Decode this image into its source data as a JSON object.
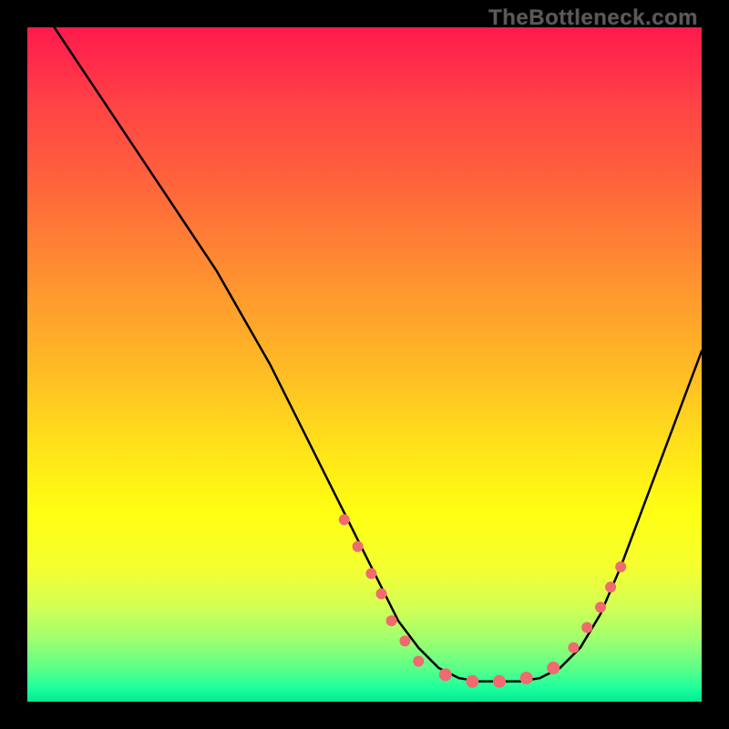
{
  "branding": {
    "text": "TheBottleneck.com"
  },
  "chart_data": {
    "type": "line",
    "title": "",
    "xlabel": "",
    "ylabel": "",
    "xlim": [
      0,
      100
    ],
    "ylim": [
      0,
      100
    ],
    "grid": false,
    "series": [
      {
        "name": "curve",
        "x": [
          4,
          8,
          12,
          16,
          20,
          24,
          28,
          32,
          36,
          40,
          44,
          48,
          52,
          55,
          58,
          61,
          64,
          67,
          70,
          73,
          76,
          79,
          82,
          85,
          88,
          91,
          94,
          97,
          100
        ],
        "y": [
          100,
          94,
          88,
          82,
          76,
          70,
          64,
          57,
          50,
          42,
          34,
          26,
          18,
          12,
          8,
          5,
          3.5,
          3,
          3,
          3,
          3.5,
          5,
          8,
          13,
          20,
          28,
          36,
          44,
          52
        ],
        "color": "#000000"
      }
    ],
    "markers": [
      {
        "x": 47,
        "y": 27,
        "r": 6,
        "color": "#f06a6f"
      },
      {
        "x": 49,
        "y": 23,
        "r": 6,
        "color": "#f06a6f"
      },
      {
        "x": 51,
        "y": 19,
        "r": 6,
        "color": "#f06a6f"
      },
      {
        "x": 52.5,
        "y": 16,
        "r": 6,
        "color": "#f06a6f"
      },
      {
        "x": 54,
        "y": 12,
        "r": 6,
        "color": "#f06a6f"
      },
      {
        "x": 56,
        "y": 9,
        "r": 6,
        "color": "#f06a6f"
      },
      {
        "x": 58,
        "y": 6,
        "r": 6,
        "color": "#f06a6f"
      },
      {
        "x": 62,
        "y": 4,
        "r": 7,
        "color": "#f06a6f"
      },
      {
        "x": 66,
        "y": 3,
        "r": 7,
        "color": "#f06a6f"
      },
      {
        "x": 70,
        "y": 3,
        "r": 7,
        "color": "#f06a6f"
      },
      {
        "x": 74,
        "y": 3.5,
        "r": 7,
        "color": "#f06a6f"
      },
      {
        "x": 78,
        "y": 5,
        "r": 7,
        "color": "#f06a6f"
      },
      {
        "x": 81,
        "y": 8,
        "r": 6,
        "color": "#f06a6f"
      },
      {
        "x": 83,
        "y": 11,
        "r": 6,
        "color": "#f06a6f"
      },
      {
        "x": 85,
        "y": 14,
        "r": 6,
        "color": "#f06a6f"
      },
      {
        "x": 86.5,
        "y": 17,
        "r": 6,
        "color": "#f06a6f"
      },
      {
        "x": 88,
        "y": 20,
        "r": 6,
        "color": "#f06a6f"
      }
    ]
  }
}
